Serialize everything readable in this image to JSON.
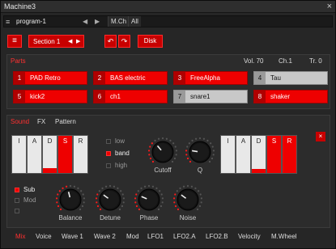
{
  "window": {
    "title": "Machine3",
    "close_glyph": "×"
  },
  "program": {
    "menu_glyph": "≡",
    "name": "program-1",
    "prev": "◀",
    "next": "▶",
    "mch": "M.Ch",
    "all": "All"
  },
  "toolbar": {
    "menu_glyph": "≡",
    "section": "Section 1",
    "prev": "◀",
    "next": "▶",
    "undo": "↶",
    "redo": "↷",
    "disk": "Disk"
  },
  "parts": {
    "title": "Parts",
    "vol": "Vol. 70",
    "ch": "Ch.1",
    "tr": "Tr. 0",
    "items": [
      {
        "num": "1",
        "name": "PAD Retro",
        "on": true
      },
      {
        "num": "2",
        "name": "BAS electric",
        "on": true
      },
      {
        "num": "3",
        "name": "FreeAlpha",
        "on": true
      },
      {
        "num": "4",
        "name": "Tau",
        "on": false
      },
      {
        "num": "5",
        "name": "kick2",
        "on": true
      },
      {
        "num": "6",
        "name": "ch1",
        "on": true
      },
      {
        "num": "7",
        "name": "snare1",
        "on": false
      },
      {
        "num": "8",
        "name": "shaker",
        "on": true
      }
    ]
  },
  "sound": {
    "tabs": [
      "Sound",
      "FX",
      "Pattern"
    ],
    "close": "×",
    "env1": [
      {
        "label": "I",
        "fill": 0
      },
      {
        "label": "A",
        "fill": 0
      },
      {
        "label": "D",
        "fill": 0.12
      },
      {
        "label": "S",
        "fill": 1.0
      },
      {
        "label": "R",
        "fill": 0
      }
    ],
    "env2": [
      {
        "label": "I",
        "fill": 0
      },
      {
        "label": "A",
        "fill": 0
      },
      {
        "label": "D",
        "fill": 0.1
      },
      {
        "label": "S",
        "fill": 1.0
      },
      {
        "label": "R",
        "fill": 1.0
      }
    ],
    "filter": [
      {
        "label": "low",
        "on": false
      },
      {
        "label": "band",
        "on": true
      },
      {
        "label": "high",
        "on": false
      }
    ],
    "mods": [
      {
        "label": "Sub",
        "on": true
      },
      {
        "label": "Mod",
        "on": false
      },
      {
        "label": "",
        "on": false
      }
    ],
    "knobs": {
      "cutoff": {
        "label": "Cutoff",
        "value": 0.35
      },
      "q": {
        "label": "Q",
        "value": 0.2
      },
      "balance": {
        "label": "Balance",
        "value": 0.45
      },
      "detune": {
        "label": "Detune",
        "value": 0.3
      },
      "phase": {
        "label": "Phase",
        "value": 0.25
      },
      "noise": {
        "label": "Noise",
        "value": 0.3
      }
    }
  },
  "bottom_tabs": [
    "Mix",
    "Voice",
    "Wave 1",
    "Wave 2",
    "Mod",
    "LFO1",
    "LFO2.A",
    "LFO2.B",
    "Velocity",
    "M.Wheel"
  ],
  "colors": {
    "accent": "#ee0000",
    "panel": "#2c2c2c",
    "off_part": "#c8c8c8"
  }
}
